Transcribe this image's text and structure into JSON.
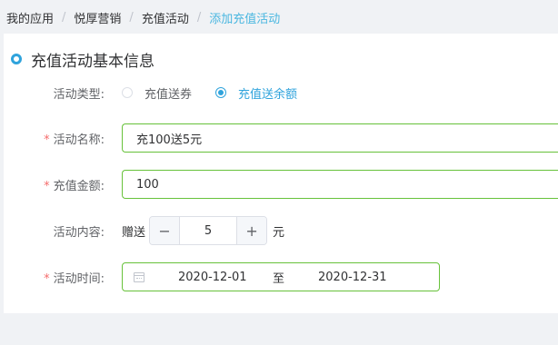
{
  "breadcrumb": {
    "items": [
      "我的应用",
      "悦厚营销",
      "充值活动",
      "添加充值活动"
    ],
    "separator": "/"
  },
  "section": {
    "title": "充值活动基本信息"
  },
  "form": {
    "type": {
      "label": "活动类型:",
      "options": [
        "充值送券",
        "充值送余额"
      ],
      "selected": "充值送余额"
    },
    "name": {
      "label": "活动名称:",
      "value": "充100送5元",
      "required": true
    },
    "amount": {
      "label": "充值金额:",
      "value": "100",
      "required": true
    },
    "content": {
      "label": "活动内容:",
      "prefix": "赠送",
      "value": "5",
      "suffix": "元",
      "minus_icon": "minus-icon",
      "plus_icon": "plus-icon"
    },
    "time": {
      "label": "活动时间:",
      "required": true,
      "start": "2020-12-01",
      "separator": "至",
      "end": "2020-12-31",
      "icon": "calendar-icon"
    }
  },
  "colors": {
    "accent": "#2fa3dc",
    "valid_border": "#67c23a",
    "required": "#f56c6c",
    "breadcrumb_current": "#4ab7e0"
  }
}
